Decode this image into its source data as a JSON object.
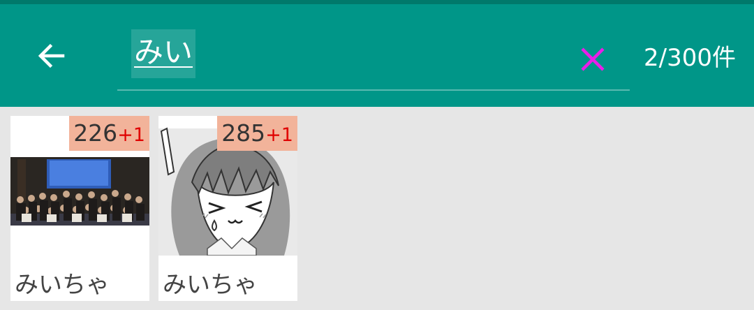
{
  "toolbar": {
    "search_query": "みい",
    "result_count": "2/300件",
    "back_icon": "arrow-left-icon",
    "clear_icon": "close-icon",
    "clear_icon_color": "#e91ee9",
    "bar_color": "#009688"
  },
  "results": [
    {
      "score": "226",
      "bonus": "+1",
      "name": "みいちゃ",
      "thumbnail": "group-photo"
    },
    {
      "score": "285",
      "bonus": "+1",
      "name": "みいちゃ",
      "thumbnail": "manga-girl-illustration"
    }
  ]
}
